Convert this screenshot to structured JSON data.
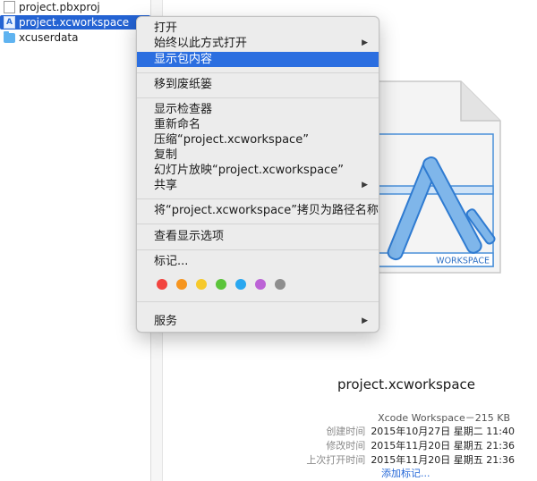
{
  "files": [
    {
      "name": "project.pbxproj",
      "icon": "document-icon",
      "selected": false
    },
    {
      "name": "project.xcworkspace",
      "icon": "xcworkspace-icon",
      "selected": true
    },
    {
      "name": "xcuserdata",
      "icon": "folder-icon",
      "selected": false
    }
  ],
  "menu": {
    "open": "打开",
    "open_with": "始终以此方式打开",
    "show_package_contents": "显示包内容",
    "move_to_trash": "移到废纸篓",
    "get_info": "显示检查器",
    "rename": "重新命名",
    "compress": "压缩“project.xcworkspace”",
    "duplicate": "复制",
    "slideshow": "幻灯片放映“project.xcworkspace”",
    "share": "共享",
    "copy_path": "将“project.xcworkspace”拷贝为路径名称",
    "show_view_options": "查看显示选项",
    "tags": "标记...",
    "services": "服务",
    "submenu_arrow": "▶",
    "tag_colors": [
      "#f2443f",
      "#f6951f",
      "#f6c92b",
      "#5bc43a",
      "#29a7f0",
      "#bc63d6",
      "#8e8e8e"
    ]
  },
  "preview": {
    "name": "project.xcworkspace",
    "icon_label": "WORKSPACE",
    "kind": "Xcode Workspace－215 KB",
    "created_label": "创建时间",
    "created_value": "2015年10月27日 星期二 11:40",
    "modified_label": "修改时间",
    "modified_value": "2015年11月20日 星期五 21:36",
    "opened_label": "上次打开时间",
    "opened_value": "2015年11月20日 星期五 21:36",
    "add_tags": "添加标记..."
  },
  "colors": {
    "selection": "#2463d3",
    "menu_highlight": "#2b6ee0",
    "link": "#2568d8",
    "xcode_blue": "#4a90d9"
  }
}
